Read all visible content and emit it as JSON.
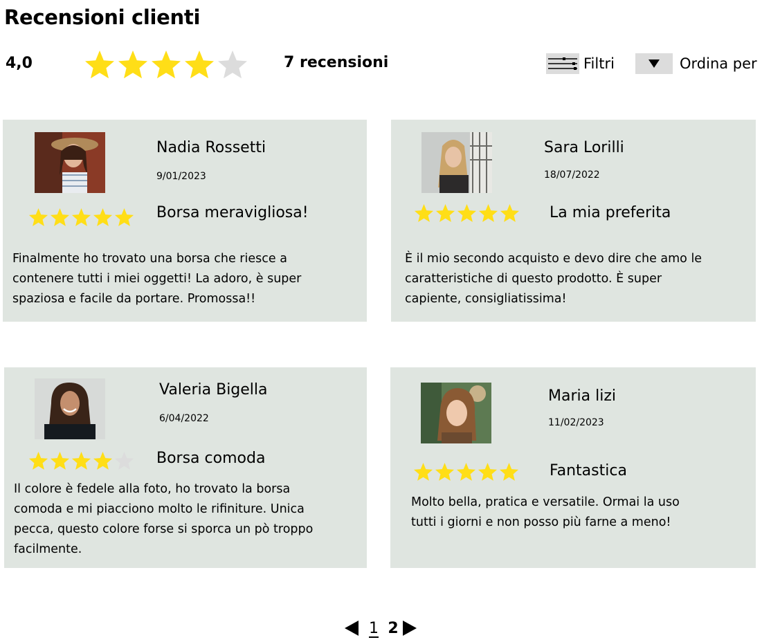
{
  "page": {
    "title": "Recensioni clienti",
    "rating_value": "4,0",
    "rating_stars": 4,
    "review_count": "7 recensioni",
    "filters_label": "Filtri",
    "sort_label": "Ordina per"
  },
  "colors": {
    "card_bg": "#dfe5e0",
    "star_on": "#ffde17",
    "star_off": "#dcdcdc"
  },
  "reviews": [
    {
      "name": "Nadia Rossetti",
      "date": "9/01/2023",
      "stars": 5,
      "headline": "Borsa meravigliosa!",
      "body": [
        "Finalmente ho trovato una borsa che riesce a",
        "contenere tutti i miei oggetti! La adoro, è super",
        "spaziosa e facile da portare. Promossa!!"
      ]
    },
    {
      "name": "Sara Lorilli",
      "date": "18/07/2022",
      "stars": 5,
      "headline": "La mia preferita",
      "body": [
        "È il mio secondo acquisto e devo dire che amo le",
        "caratteristiche di questo prodotto. È super",
        "capiente, consigliatissima!"
      ]
    },
    {
      "name": "Valeria Bigella",
      "date": "6/04/2022",
      "stars": 4,
      "headline": "Borsa comoda",
      "body": [
        "Il colore è fedele alla foto, ho trovato la borsa",
        "comoda e mi piacciono molto le rifiniture. Unica",
        "pecca, questo colore forse si sporca un pò troppo",
        "facilmente."
      ]
    },
    {
      "name": "Maria lizi",
      "date": "11/02/2023",
      "stars": 5,
      "headline": "Fantastica",
      "body": [
        "Molto bella, pratica e versatile. Ormai la uso",
        "tutti i giorni e non posso più farne a meno!"
      ]
    }
  ],
  "pagination": {
    "current": "1",
    "next": "2"
  }
}
